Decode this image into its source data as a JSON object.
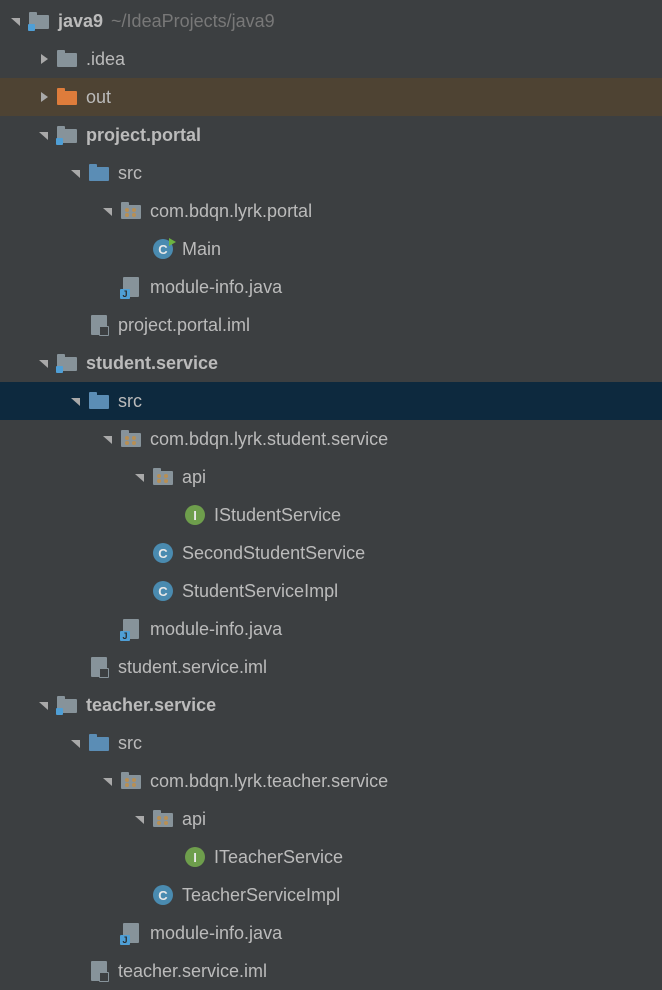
{
  "root": {
    "name": "java9",
    "path": "~/IdeaProjects/java9"
  },
  "items": [
    {
      "label": ".idea"
    },
    {
      "label": "out"
    },
    {
      "label": "project.portal"
    },
    {
      "label": "src"
    },
    {
      "label": "com.bdqn.lyrk.portal"
    },
    {
      "label": "Main"
    },
    {
      "label": "module-info.java"
    },
    {
      "label": "project.portal.iml"
    },
    {
      "label": "student.service"
    },
    {
      "label": "src"
    },
    {
      "label": "com.bdqn.lyrk.student.service"
    },
    {
      "label": "api"
    },
    {
      "label": "IStudentService"
    },
    {
      "label": "SecondStudentService"
    },
    {
      "label": "StudentServiceImpl"
    },
    {
      "label": "module-info.java"
    },
    {
      "label": "student.service.iml"
    },
    {
      "label": "teacher.service"
    },
    {
      "label": "src"
    },
    {
      "label": "com.bdqn.lyrk.teacher.service"
    },
    {
      "label": "api"
    },
    {
      "label": "ITeacherService"
    },
    {
      "label": "TeacherServiceImpl"
    },
    {
      "label": "module-info.java"
    },
    {
      "label": "teacher.service.iml"
    }
  ],
  "classLetter": "C",
  "interfaceLetter": "I"
}
